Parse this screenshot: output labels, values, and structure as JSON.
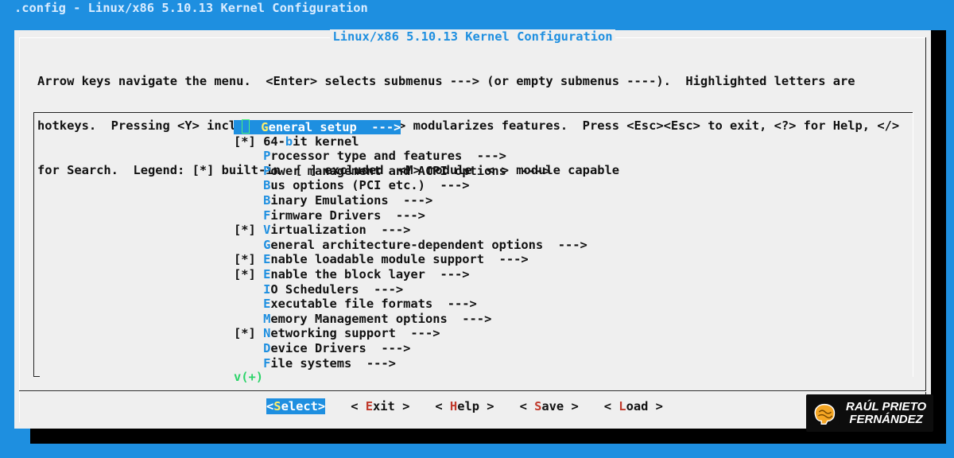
{
  "window": {
    "title": ".config - Linux/x86 5.10.13 Kernel Configuration"
  },
  "dialog": {
    "title": "Linux/x86 5.10.13 Kernel Configuration",
    "help_lines": [
      "Arrow keys navigate the menu.  <Enter> selects submenus ---> (or empty submenus ----).  Highlighted letters are",
      "hotkeys.  Pressing <Y> includes, <N> excludes, <M> modularizes features.  Press <Esc><Esc> to exit, <?> for Help, </>",
      "for Search.  Legend: [*] built-in  [ ] excluded  <M> module  < > module capable"
    ]
  },
  "menu": {
    "items": [
      {
        "prefix": "",
        "hotkey": "G",
        "rest": "eneral setup  --->",
        "selected": true
      },
      {
        "prefix": "[*] ",
        "pre": "64-",
        "hotkey": "b",
        "rest": "it kernel"
      },
      {
        "prefix": "    ",
        "hotkey": "P",
        "rest": "rocessor type and features  --->"
      },
      {
        "prefix": "    ",
        "hotkey": "P",
        "rest": "ower management and ACPI options  --->"
      },
      {
        "prefix": "    ",
        "hotkey": "B",
        "rest": "us options (PCI etc.)  --->"
      },
      {
        "prefix": "    ",
        "hotkey": "B",
        "rest": "inary Emulations  --->"
      },
      {
        "prefix": "    ",
        "hotkey": "F",
        "rest": "irmware Drivers  --->"
      },
      {
        "prefix": "[*] ",
        "hotkey": "V",
        "rest": "irtualization  --->"
      },
      {
        "prefix": "    ",
        "hotkey": "G",
        "rest": "eneral architecture-dependent options  --->"
      },
      {
        "prefix": "[*] ",
        "hotkey": "E",
        "rest": "nable loadable module support  --->"
      },
      {
        "prefix": "[*] ",
        "hotkey": "E",
        "rest": "nable the block layer  --->"
      },
      {
        "prefix": "    ",
        "hotkey": "I",
        "rest": "O Schedulers  --->"
      },
      {
        "prefix": "    ",
        "hotkey": "E",
        "rest": "xecutable file formats  --->"
      },
      {
        "prefix": "    ",
        "hotkey": "M",
        "rest": "emory Management options  --->"
      },
      {
        "prefix": "[*] ",
        "hotkey": "N",
        "rest": "etworking support  --->"
      },
      {
        "prefix": "    ",
        "hotkey": "D",
        "rest": "evice Drivers  --->"
      },
      {
        "prefix": "    ",
        "hotkey": "F",
        "rest": "ile systems  --->"
      }
    ],
    "more_indicator": "v(+)"
  },
  "buttons": [
    {
      "open": "<",
      "hotkey": "S",
      "rest": "elect",
      "close": ">",
      "active": true
    },
    {
      "open": "< ",
      "hotkey": "E",
      "rest": "xit",
      "close": " >"
    },
    {
      "open": "< ",
      "hotkey": "H",
      "rest": "elp",
      "close": " >"
    },
    {
      "open": "< ",
      "hotkey": "S",
      "rest": "ave",
      "close": " >"
    },
    {
      "open": "< ",
      "hotkey": "L",
      "rest": "oad",
      "close": " >"
    }
  ],
  "watermark": {
    "line1": "RAÚL PRIETO",
    "line2": "FERNÁNDEZ"
  },
  "colors": {
    "background": "#1e8fe0",
    "dialog": "#efefef",
    "hotkey": "#1e8fe0",
    "button_hotkey": "#c0392b",
    "more": "#2dd46a"
  }
}
